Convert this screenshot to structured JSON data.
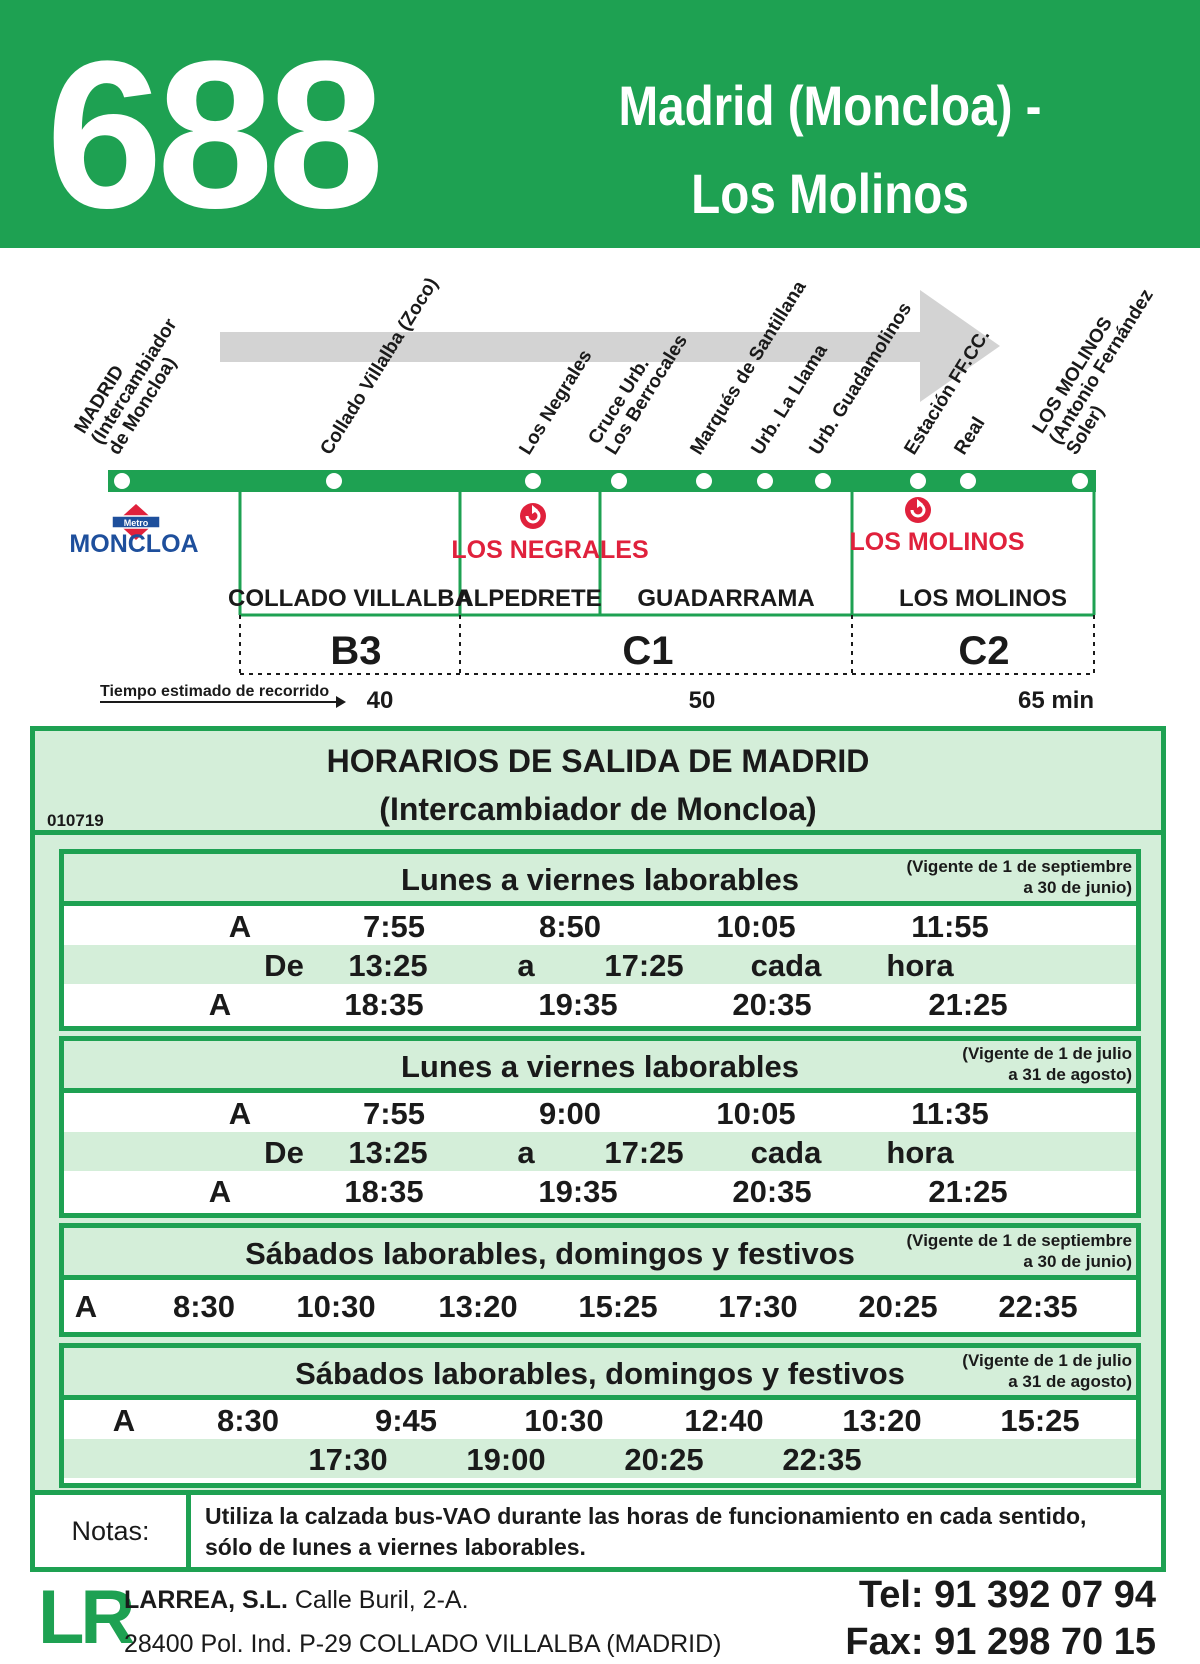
{
  "header": {
    "line_number": "688",
    "route_line1": "Madrid (Moncloa) -",
    "route_line2": "Los Molinos"
  },
  "route": {
    "stops": [
      {
        "lines": [
          "MADRID",
          "(Intercambiador",
          "de Moncloa)"
        ]
      },
      {
        "lines": [
          "Collado Villalba (Zoco)"
        ]
      },
      {
        "lines": [
          "Los Negrales"
        ]
      },
      {
        "lines": [
          "Cruce Urb.",
          "Los Berrocales"
        ]
      },
      {
        "lines": [
          "Marqués de Santillana"
        ]
      },
      {
        "lines": [
          "Urb. La Llama"
        ]
      },
      {
        "lines": [
          "Urb. Guadamolinos"
        ]
      },
      {
        "lines": [
          "Estación FF.CC."
        ]
      },
      {
        "lines": [
          "Real"
        ]
      },
      {
        "lines": [
          "LOS MOLINOS",
          "(Antonio Fernández",
          "Soler)"
        ]
      }
    ],
    "metro_badge": "Metro",
    "metro_station": "MONCLOA",
    "rail_stations": [
      "LOS NEGRALES",
      "LOS MOLINOS"
    ],
    "municipalities": [
      "COLLADO VILLALBA",
      "ALPEDRETE",
      "GUADARRAMA",
      "LOS MOLINOS"
    ],
    "zones": [
      "B3",
      "C1",
      "C2"
    ],
    "time_caption": "Tiempo estimado de recorrido",
    "times": [
      "40",
      "50",
      "65 min"
    ]
  },
  "schedule": {
    "title_line1": "HORARIOS DE SALIDA DE MADRID",
    "title_line2": "(Intercambiador de Moncloa)",
    "code": "010719",
    "blocks": [
      {
        "title": "Lunes a viernes laborables",
        "validity_line1": "(Vigente de 1 de septiembre",
        "validity_line2": "a 30 de junio)",
        "rows": [
          [
            "A",
            "7:55",
            "8:50",
            "10:05",
            "11:55"
          ],
          [
            "De",
            "13:25",
            "a",
            "17:25",
            "cada",
            "hora"
          ],
          [
            "A",
            "18:35",
            "19:35",
            "20:35",
            "21:25"
          ]
        ]
      },
      {
        "title": "Lunes a viernes laborables",
        "validity_line1": "(Vigente de 1 de julio",
        "validity_line2": "a 31 de agosto)",
        "rows": [
          [
            "A",
            "7:55",
            "9:00",
            "10:05",
            "11:35"
          ],
          [
            "De",
            "13:25",
            "a",
            "17:25",
            "cada",
            "hora"
          ],
          [
            "A",
            "18:35",
            "19:35",
            "20:35",
            "21:25"
          ]
        ]
      },
      {
        "title": "Sábados laborables, domingos y festivos",
        "validity_line1": "(Vigente de 1 de septiembre",
        "validity_line2": "a 30 de junio)",
        "rows": [
          [
            "A",
            "8:30",
            "10:30",
            "13:20",
            "15:25",
            "17:30",
            "20:25",
            "22:35"
          ]
        ]
      },
      {
        "title": "Sábados laborables, domingos y festivos",
        "validity_line1": "(Vigente de 1 de julio",
        "validity_line2": "a 31 de agosto)",
        "rows": [
          [
            "A",
            "8:30",
            "9:45",
            "10:30",
            "12:40",
            "13:20",
            "15:25"
          ],
          [
            "17:30",
            "19:00",
            "20:25",
            "22:35"
          ]
        ]
      }
    ]
  },
  "notes": {
    "label": "Notas:",
    "text_line1": "Utiliza la calzada bus-VAO durante las horas de funcionamiento en cada sentido,",
    "text_line2": "sólo de lunes a viernes laborables."
  },
  "footer": {
    "logo": "LR",
    "company_name": "LARREA, S.L.",
    "street": "Calle Buril, 2-A.",
    "address": "28400 Pol. Ind. P-29 COLLADO VILLALBA (MADRID)",
    "tel": "Tel: 91 392 07 94",
    "fax": "Fax: 91 298 70 15"
  },
  "colors": {
    "brand_green": "#1ea152",
    "light_green": "#d4eed9",
    "rail_red": "#e0213c",
    "metro_blue": "#1e4f9c"
  }
}
